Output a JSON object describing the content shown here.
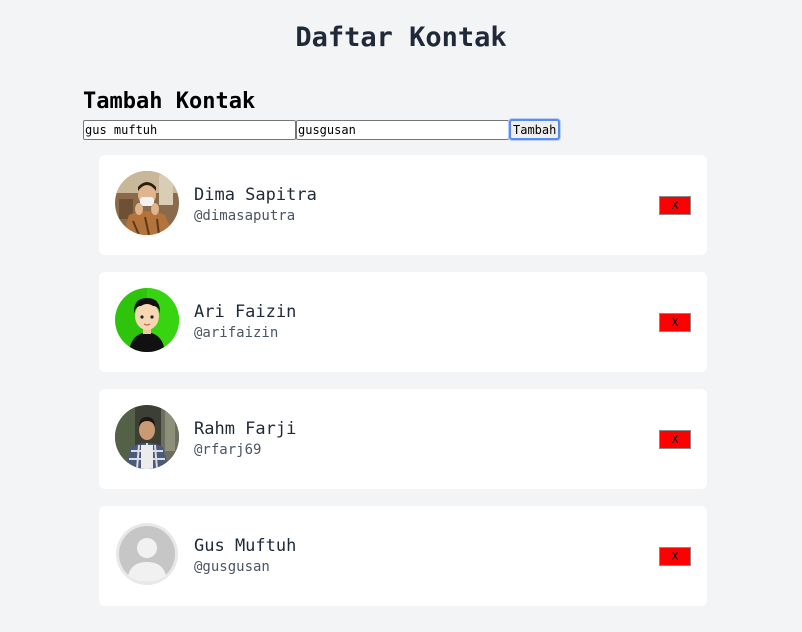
{
  "page": {
    "title": "Daftar Kontak"
  },
  "form": {
    "heading": "Tambah Kontak",
    "name_value": "gus muftuh",
    "handle_value": "gusgusan",
    "submit_label": "Tambah"
  },
  "contacts": [
    {
      "name": "Dima Sapitra",
      "handle": "@dimasaputra",
      "avatar": "photo-man-masked-brown",
      "delete_label": "X"
    },
    {
      "name": "Ari Faizin",
      "handle": "@arifaizin",
      "avatar": "cartoon-avatar-green",
      "delete_label": "X"
    },
    {
      "name": "Rahm Farji",
      "handle": "@rfarj69",
      "avatar": "photo-man-plaid-shirt",
      "delete_label": "X"
    },
    {
      "name": "Gus Muftuh",
      "handle": "@gusgusan",
      "avatar": "default-user-placeholder",
      "delete_label": "X"
    }
  ],
  "colors": {
    "background": "#f3f4f6",
    "card": "#ffffff",
    "delete_button": "#ff0000",
    "focus_ring": "#5b8def"
  }
}
